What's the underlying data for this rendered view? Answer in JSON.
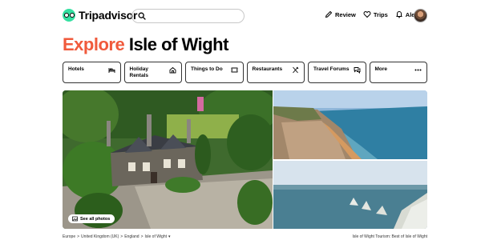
{
  "header": {
    "logo_text": "Tripadvisor",
    "search": {
      "placeholder": ""
    },
    "nav": [
      {
        "label": "Review",
        "icon": "pencil-icon"
      },
      {
        "label": "Trips",
        "icon": "heart-icon"
      },
      {
        "label": "Alerts",
        "icon": "bell-icon"
      }
    ],
    "brand_color": "#34e0a1"
  },
  "title": {
    "accent": "Explore",
    "place": "Isle of Wight",
    "accent_color": "#f05a3c"
  },
  "categories": [
    {
      "label": "Hotels",
      "icon": "bed-icon"
    },
    {
      "label": "Holiday\nRentals",
      "icon": "house-icon"
    },
    {
      "label": "Things to Do",
      "icon": "ticket-icon"
    },
    {
      "label": "Restaurants",
      "icon": "cutlery-icon"
    },
    {
      "label": "Travel Forums",
      "icon": "chat-icon"
    },
    {
      "label": "More",
      "icon": "more-dots-icon"
    }
  ],
  "photos": {
    "see_all_label": "See all photos",
    "items": [
      "model-village-photo",
      "cliffs-coast-photo",
      "needles-photo"
    ]
  },
  "breadcrumb": [
    "Europe",
    "United Kingdom (UK)",
    "England",
    "Isle of Wight"
  ],
  "footer": {
    "tourism_title": "Isle of Wight Tourism: Best of Isle of Wight"
  }
}
